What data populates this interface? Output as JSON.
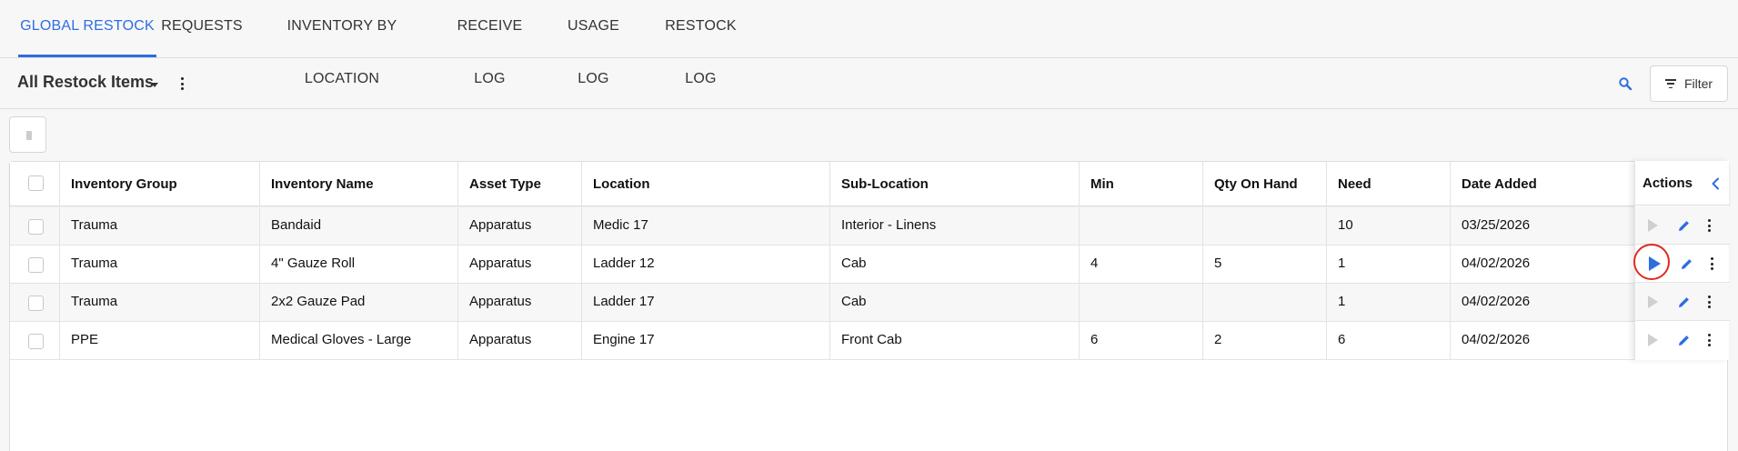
{
  "tabs": [
    {
      "label": "GLOBAL RESTOCK",
      "active": true
    },
    {
      "label": "REQUESTS"
    },
    {
      "label": "INVENTORY BY LOCATION"
    },
    {
      "label": "RECEIVE LOG"
    },
    {
      "label": "USAGE LOG"
    },
    {
      "label": "RESTOCK LOG"
    }
  ],
  "toolbar": {
    "view_title": "All Restock Items",
    "filter_label": "Filter",
    "icons": [
      "caret-down-icon",
      "kebab-icon",
      "search-icon",
      "filter-icon"
    ]
  },
  "table": {
    "columns": [
      "Inventory Group",
      "Inventory Name",
      "Asset Type",
      "Location",
      "Sub-Location",
      "Min",
      "Qty On Hand",
      "Need",
      "Date Added"
    ],
    "actions_label": "Actions",
    "rows": [
      {
        "group": "Trauma",
        "name": "Bandaid",
        "asset_type": "Apparatus",
        "location": "Medic 17",
        "sub_location": "Interior - Linens",
        "min": "",
        "qty": "",
        "need": "10",
        "date": "03/25/2026",
        "play_active": false
      },
      {
        "group": "Trauma",
        "name": "4\" Gauze Roll",
        "asset_type": "Apparatus",
        "location": "Ladder 12",
        "sub_location": "Cab",
        "min": "4",
        "qty": "5",
        "need": "1",
        "date": "04/02/2026",
        "play_active": true
      },
      {
        "group": "Trauma",
        "name": "2x2 Gauze Pad",
        "asset_type": "Apparatus",
        "location": "Ladder 17",
        "sub_location": "Cab",
        "min": "",
        "qty": "",
        "need": "1",
        "date": "04/02/2026",
        "play_active": false
      },
      {
        "group": "PPE",
        "name": "Medical Gloves - Large",
        "asset_type": "Apparatus",
        "location": "Engine 17",
        "sub_location": "Front Cab",
        "min": "6",
        "qty": "2",
        "need": "6",
        "date": "04/02/2026",
        "play_active": false
      }
    ]
  },
  "colors": {
    "accent": "#2d6ee0",
    "highlight_ring": "#e02a1f",
    "disabled": "#cfcfcf"
  }
}
